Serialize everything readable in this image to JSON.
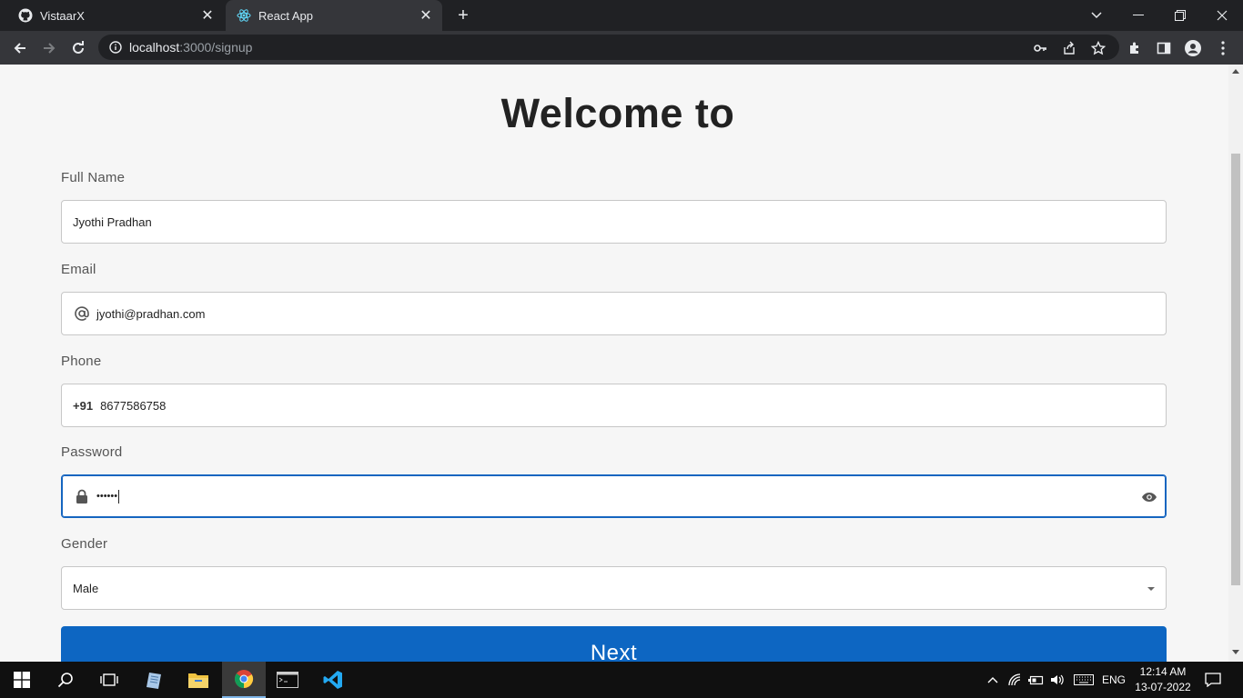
{
  "browser": {
    "tabs": [
      {
        "title": "VistaarX",
        "icon": "github-icon"
      },
      {
        "title": "React App",
        "icon": "react-icon"
      }
    ],
    "url_host": "localhost",
    "url_path": ":3000/signup"
  },
  "page": {
    "heading": "Welcome to",
    "fields": {
      "full_name": {
        "label": "Full Name",
        "value": "Jyothi Pradhan"
      },
      "email": {
        "label": "Email",
        "value": "jyothi@pradhan.com",
        "icon": "at-icon"
      },
      "phone": {
        "label": "Phone",
        "prefix": "+91",
        "value": "8677586758"
      },
      "password": {
        "label": "Password",
        "value": "••••••",
        "icon": "lock-icon",
        "toggle_icon": "eye-icon"
      },
      "gender": {
        "label": "Gender",
        "value": "Male"
      }
    },
    "next_label": "Next"
  },
  "colors": {
    "primary": "#0d66c2",
    "focus_border": "#1565c0",
    "page_bg": "#f6f6f6"
  },
  "taskbar": {
    "language": "ENG",
    "time": "12:14 AM",
    "date": "13-07-2022"
  }
}
